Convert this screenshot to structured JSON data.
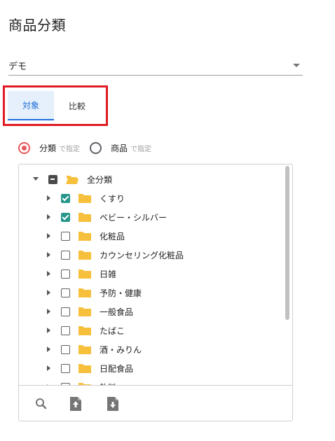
{
  "page": {
    "title": "商品分類"
  },
  "select": {
    "value": "デモ"
  },
  "tabs": [
    {
      "label": "対象",
      "active": true
    },
    {
      "label": "比較",
      "active": false
    }
  ],
  "mode": {
    "options": [
      {
        "label": "分類",
        "hint": "で指定",
        "checked": true
      },
      {
        "label": "商品",
        "hint": "で指定",
        "checked": false
      }
    ]
  },
  "tree": {
    "root": {
      "label": "全分類",
      "state": "indeterminate",
      "expanded": true
    },
    "items": [
      {
        "label": "くすり",
        "checked": true
      },
      {
        "label": "ベビー・シルバー",
        "checked": true
      },
      {
        "label": "化粧品",
        "checked": false
      },
      {
        "label": "カウンセリング化粧品",
        "checked": false
      },
      {
        "label": "日雑",
        "checked": false
      },
      {
        "label": "予防・健康",
        "checked": false
      },
      {
        "label": "一般食品",
        "checked": false
      },
      {
        "label": "たばこ",
        "checked": false
      },
      {
        "label": "酒・みりん",
        "checked": false
      },
      {
        "label": "日配食品",
        "checked": false
      },
      {
        "label": "飲料",
        "checked": false
      }
    ]
  },
  "colors": {
    "accent_blue": "#1e6fd9",
    "checkbox_teal": "#26968a",
    "radio_red": "#e8595d",
    "folder_yellow": "#f7c03c",
    "highlight_red": "#e01b24"
  },
  "toolbar": {
    "icons": [
      "search-icon",
      "upload-file-icon",
      "download-file-icon"
    ]
  }
}
